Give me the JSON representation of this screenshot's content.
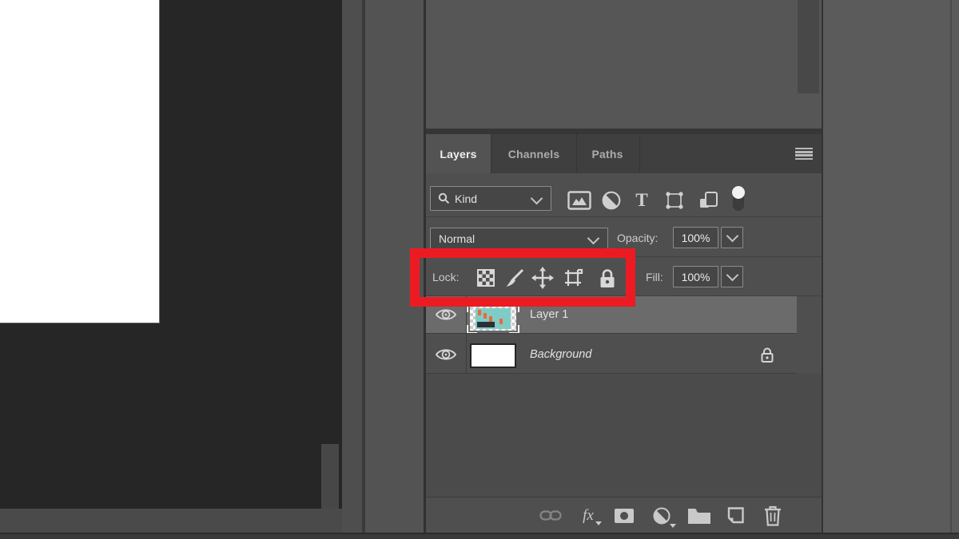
{
  "panel_tabs": {
    "layers": "Layers",
    "channels": "Channels",
    "paths": "Paths"
  },
  "filter_row": {
    "kind_value": "Kind"
  },
  "blend_row": {
    "mode": "Normal",
    "opacity_label": "Opacity:",
    "opacity_value": "100%"
  },
  "lock_row": {
    "lock_label": "Lock:",
    "fill_label": "Fill:",
    "fill_value": "100%"
  },
  "layers_list": [
    {
      "name": "Layer 1",
      "state": "selected",
      "visible": true
    },
    {
      "name": "Background",
      "state": "locked",
      "visible": true
    }
  ],
  "toolbar": {
    "fx_label": "fx"
  },
  "colors": {
    "highlight_red": "#ec1b23",
    "selected_row": "#6b6b6b",
    "panel_bg": "#4f4f4f",
    "thumbnail_teal": "#7fccc6"
  }
}
